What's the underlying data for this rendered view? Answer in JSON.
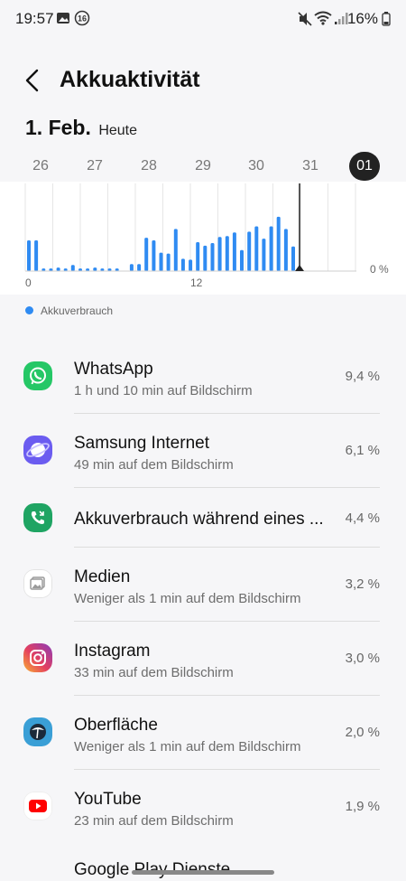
{
  "status_bar": {
    "time": "19:57",
    "battery": "16%",
    "notif_badge": "16"
  },
  "header": {
    "title": "Akkuaktivität"
  },
  "date": {
    "main": "1. Feb.",
    "sub": "Heute"
  },
  "days": [
    "26",
    "27",
    "28",
    "29",
    "30",
    "31",
    "01"
  ],
  "selected_day": "01",
  "chart_data": {
    "type": "bar",
    "x_tick_labels": [
      "0",
      "12"
    ],
    "y_tick_label": "0 %",
    "series": [
      {
        "name": "Akkuverbrauch",
        "color": "#2f8bf2",
        "values": [
          35,
          35,
          3,
          3,
          4,
          3,
          7,
          3,
          3,
          4,
          3,
          3,
          3,
          0,
          8,
          8,
          38,
          35,
          21,
          20,
          48,
          14,
          13,
          33,
          29,
          32,
          39,
          40,
          44,
          24,
          45,
          51,
          37,
          51,
          62,
          48,
          28
        ]
      }
    ],
    "legend": [
      "Akkuverbrauch"
    ],
    "grid": true
  },
  "legend": {
    "label": "Akkuverbrauch",
    "color": "#2f8bf2"
  },
  "apps": [
    {
      "name": "WhatsApp",
      "sub": "1 h und 10 min auf Bildschirm",
      "pct": "9,4 %",
      "icon": "whatsapp-icon"
    },
    {
      "name": "Samsung Internet",
      "sub": "49 min auf dem Bildschirm",
      "pct": "6,1 %",
      "icon": "samsung-internet-icon"
    },
    {
      "name": "Akkuverbrauch während eines ...",
      "sub": "",
      "pct": "4,4 %",
      "icon": "call-icon"
    },
    {
      "name": "Medien",
      "sub": "Weniger als 1 min auf dem Bildschirm",
      "pct": "3,2 %",
      "icon": "media-icon"
    },
    {
      "name": "Instagram",
      "sub": "33 min auf dem Bildschirm",
      "pct": "3,0 %",
      "icon": "instagram-icon"
    },
    {
      "name": "Oberfläche",
      "sub": "Weniger als 1 min auf dem Bildschirm",
      "pct": "2,0 %",
      "icon": "ui-icon"
    },
    {
      "name": "YouTube",
      "sub": "23 min auf dem Bildschirm",
      "pct": "1,9 %",
      "icon": "youtube-icon"
    }
  ],
  "cut_off_item": "Google Play Dienste"
}
